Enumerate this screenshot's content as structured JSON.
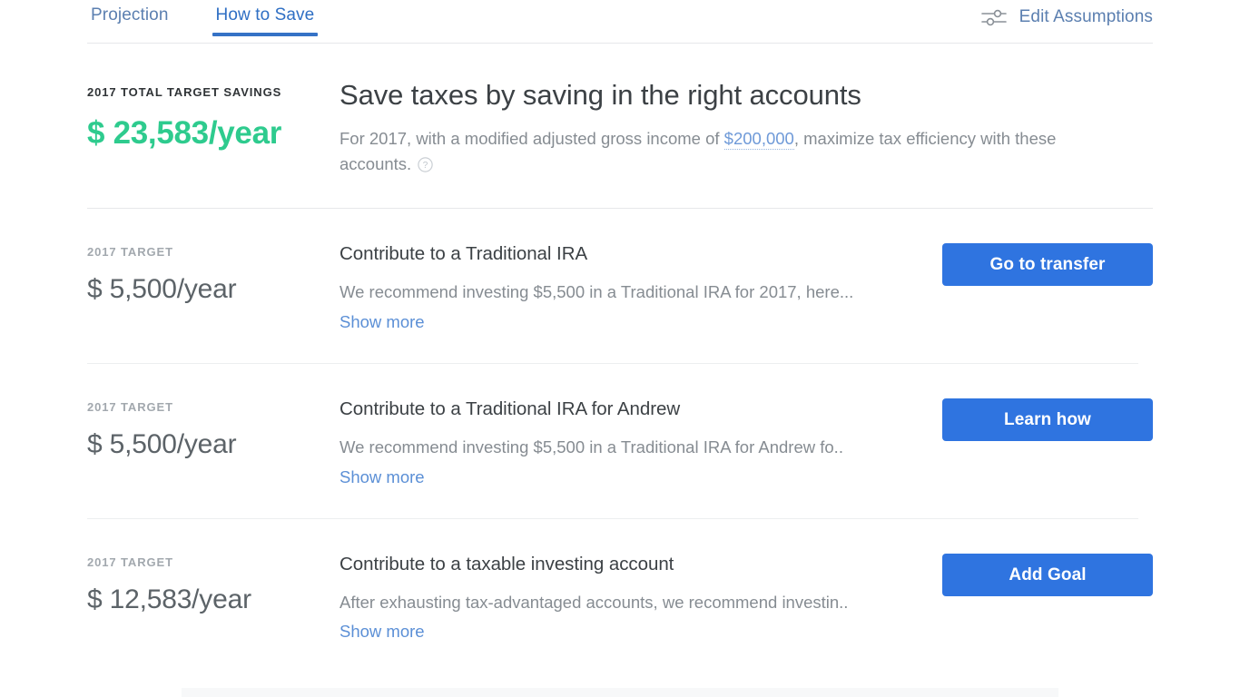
{
  "tabs": [
    {
      "label": "Projection",
      "active": false
    },
    {
      "label": "How to Save",
      "active": true
    }
  ],
  "header": {
    "edit_assumptions_label": "Edit Assumptions",
    "sliders_icon": "sliders-icon"
  },
  "hero": {
    "eyebrow": "2017 TOTAL TARGET SAVINGS",
    "amount": "$ 23,583/year",
    "amount_color": "#2ecb8e",
    "title": "Save taxes by saving in the right accounts",
    "desc_before": "For 2017, with a modified adjusted gross income of ",
    "desc_link": "$200,000",
    "desc_after": ", maximize tax efficiency with these accounts.",
    "help_icon": "help-circle-icon"
  },
  "recommendations": [
    {
      "eyebrow": "2017 TARGET",
      "amount": "$ 5,500/year",
      "title": "Contribute to a Traditional IRA",
      "description": "We recommend investing $5,500 in a Traditional IRA for 2017, here...",
      "show_more": "Show more",
      "button": "Go to transfer"
    },
    {
      "eyebrow": "2017 TARGET",
      "amount": "$ 5,500/year",
      "title": "Contribute to a Traditional IRA for Andrew",
      "description": "We recommend investing $5,500 in a Traditional IRA for Andrew fo..",
      "show_more": "Show more",
      "button": "Learn how"
    },
    {
      "eyebrow": "2017 TARGET",
      "amount": "$ 12,583/year",
      "title": "Contribute to a taxable investing account",
      "description": "After exhausting tax-advantaged accounts, we recommend investin..",
      "show_more": "Show more",
      "button": "Add Goal"
    }
  ],
  "colors": {
    "accent_blue": "#2f74e0",
    "tab_blue": "#3572c6",
    "link_blue": "#5b8fd6",
    "green": "#2ecb8e",
    "text_dark": "#3c4145",
    "text_muted": "#868c92"
  }
}
